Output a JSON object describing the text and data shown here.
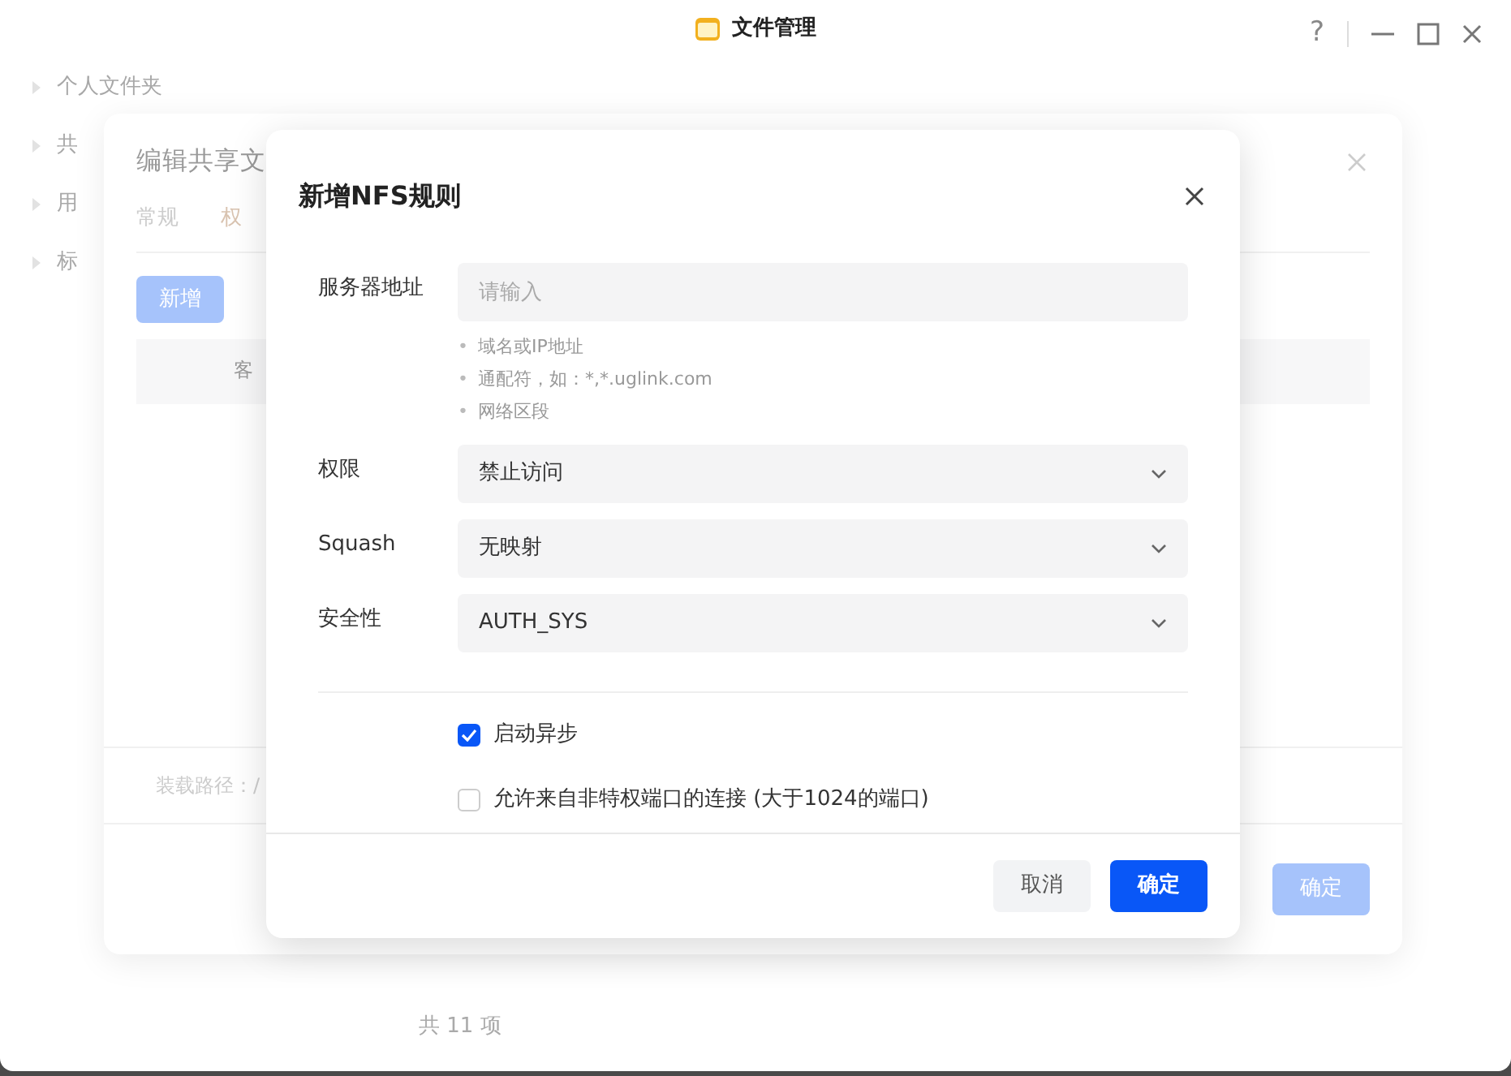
{
  "app_window": {
    "title": "文件管理",
    "help": "?"
  },
  "sidebar": {
    "items": [
      {
        "label": "个人文件夹"
      },
      {
        "label": "共"
      },
      {
        "label": "用"
      },
      {
        "label": "标"
      }
    ]
  },
  "file_list": {
    "footer": "共 11 项"
  },
  "share_dialog": {
    "title": "编辑共享文",
    "tabs": [
      {
        "label": "常规",
        "selected": false
      },
      {
        "label": "权",
        "selected": true
      }
    ],
    "add_button": "新增",
    "table": {
      "columns": [
        "客"
      ]
    },
    "mount_path": "装载路径：/",
    "confirm_button": "确定"
  },
  "nfs_dialog": {
    "title": "新增NFS规则",
    "fields": [
      {
        "kind": "input",
        "label": "服务器地址",
        "placeholder": "请输入",
        "hint_marker": "•",
        "hints": [
          "域名或IP地址",
          "通配符，如：*,*.uglink.com",
          "网络区段"
        ]
      },
      {
        "kind": "select",
        "label": "权限",
        "value": "禁止访问"
      },
      {
        "kind": "select",
        "label": "Squash",
        "value": "无映射"
      },
      {
        "kind": "select",
        "label": "安全性",
        "value": "AUTH_SYS"
      }
    ],
    "options": [
      {
        "label": "启动异步",
        "checked": true
      },
      {
        "label": "允许来自非特权端口的连接 (大于1024的端口)",
        "checked": false
      }
    ],
    "buttons": [
      {
        "label": "取消",
        "kind": "secondary"
      },
      {
        "label": "确定",
        "kind": "primary"
      }
    ]
  }
}
